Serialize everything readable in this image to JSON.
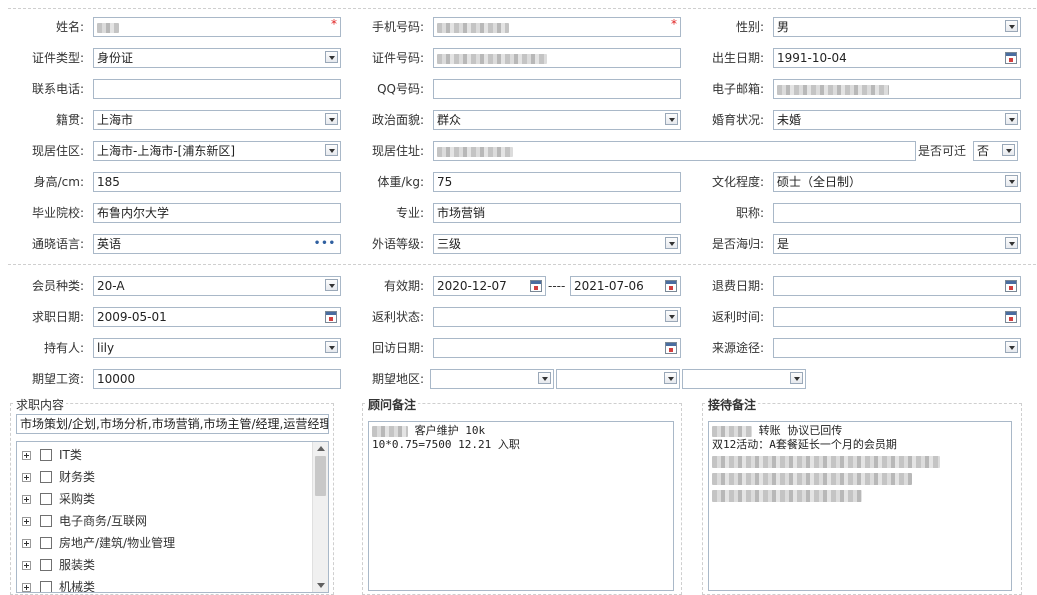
{
  "fields": {
    "name": {
      "label": "姓名:",
      "value": "",
      "required": "*"
    },
    "mobile": {
      "label": "手机号码:",
      "value": "",
      "required": "*"
    },
    "gender": {
      "label": "性别:",
      "value": "男"
    },
    "id_type": {
      "label": "证件类型:",
      "value": "身份证"
    },
    "id_number": {
      "label": "证件号码:",
      "value": ""
    },
    "birth_date": {
      "label": "出生日期:",
      "value": "1991-10-04"
    },
    "phone": {
      "label": "联系电话:",
      "value": ""
    },
    "qq": {
      "label": "QQ号码:",
      "value": ""
    },
    "email": {
      "label": "电子邮箱:",
      "value": ""
    },
    "native_place": {
      "label": "籍贯:",
      "value": "上海市"
    },
    "political": {
      "label": "政治面貌:",
      "value": "群众"
    },
    "marital": {
      "label": "婚育状况:",
      "value": "未婚"
    },
    "residence_area": {
      "label": "现居住区:",
      "value": "上海市-上海市-[浦东新区]"
    },
    "residence_address": {
      "label": "现居住址:",
      "value": ""
    },
    "relocate": {
      "label": "是否可迁",
      "value": "否"
    },
    "height": {
      "label": "身高/cm:",
      "value": "185"
    },
    "weight": {
      "label": "体重/kg:",
      "value": "75"
    },
    "education": {
      "label": "文化程度:",
      "value": "硕士（全日制）"
    },
    "school": {
      "label": "毕业院校:",
      "value": "布鲁内尔大学"
    },
    "major": {
      "label": "专业:",
      "value": "市场营销"
    },
    "title": {
      "label": "职称:",
      "value": ""
    },
    "language": {
      "label": "通晓语言:",
      "value": "英语"
    },
    "foreign_level": {
      "label": "外语等级:",
      "value": "三级"
    },
    "returnee": {
      "label": "是否海归:",
      "value": "是"
    },
    "member_type": {
      "label": "会员种类:",
      "value": "20-A"
    },
    "valid_period": {
      "label": "有效期:",
      "start": "2020-12-07",
      "sep": "----",
      "end": "2021-07-06"
    },
    "refund_date": {
      "label": "退费日期:",
      "value": ""
    },
    "job_seek_date": {
      "label": "求职日期:",
      "value": "2009-05-01"
    },
    "rebate_status": {
      "label": "返利状态:",
      "value": ""
    },
    "rebate_time": {
      "label": "返利时间:",
      "value": ""
    },
    "holder": {
      "label": "持有人:",
      "value": "lily"
    },
    "visit_date": {
      "label": "回访日期:",
      "value": ""
    },
    "source": {
      "label": "来源途径:",
      "value": ""
    },
    "expected_salary": {
      "label": "期望工资:",
      "value": "10000"
    },
    "expected_area": {
      "label": "期望地区:",
      "values": [
        "",
        "",
        ""
      ]
    }
  },
  "job_content": {
    "title": "求职内容",
    "summary": "市场策划/企划,市场分析,市场营销,市场主管/经理,运营经理",
    "tree_items": [
      "IT类",
      "财务类",
      "采购类",
      "电子商务/互联网",
      "房地产/建筑/物业管理",
      "服装类",
      "机械类"
    ]
  },
  "advisor_notes": {
    "title": "顾问备注",
    "line1": "客户维护 10k",
    "line2": "10*0.75=7500 12.21 入职"
  },
  "reception_notes": {
    "title": "接待备注",
    "line1": "转账 协议已回传",
    "line2": "双12活动：A套餐延长一个月的会员期"
  },
  "colors": {
    "required": "#e02020",
    "border": "#a9b8c8"
  }
}
